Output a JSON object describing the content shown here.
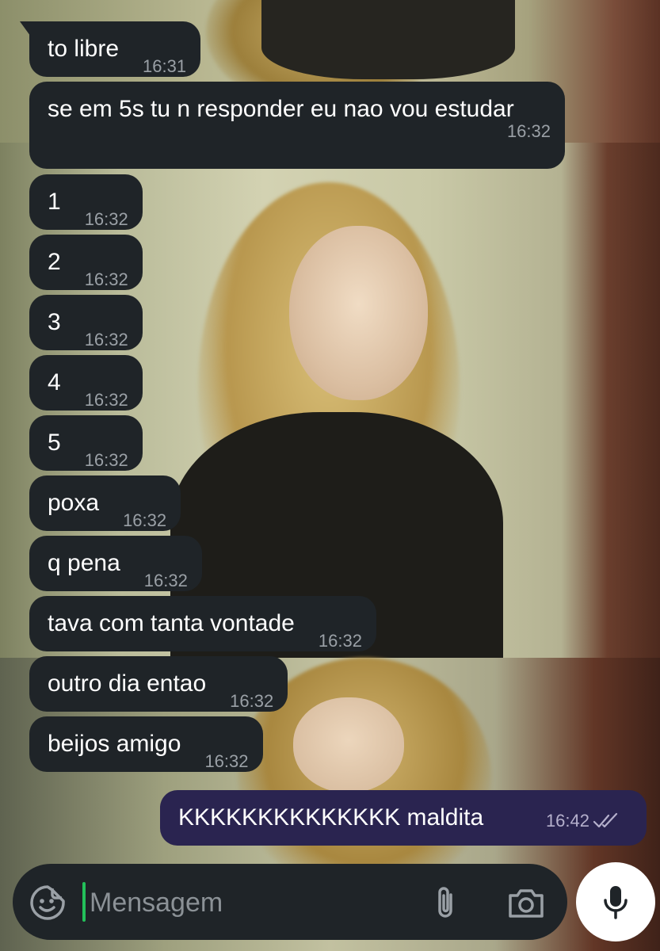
{
  "messages": [
    {
      "text": "to libre",
      "time": "16:31"
    },
    {
      "text": "se em 5s tu n responder eu nao vou estudar",
      "time": "16:32"
    },
    {
      "text": "1",
      "time": "16:32"
    },
    {
      "text": "2",
      "time": "16:32"
    },
    {
      "text": "3",
      "time": "16:32"
    },
    {
      "text": "4",
      "time": "16:32"
    },
    {
      "text": "5",
      "time": "16:32"
    },
    {
      "text": "poxa",
      "time": "16:32"
    },
    {
      "text": "q pena",
      "time": "16:32"
    },
    {
      "text": "tava com tanta vontade",
      "time": "16:32"
    },
    {
      "text": "outro dia entao",
      "time": "16:32"
    },
    {
      "text": "beijos amigo",
      "time": "16:32"
    }
  ],
  "outgoing": {
    "text": "KKKKKKKKKKKKKK maldita",
    "time": "16:42",
    "status_icon": "double-check-icon"
  },
  "composer": {
    "placeholder": "Mensagem"
  },
  "icons": {
    "emoji": "sticker-emoji-icon",
    "attach": "paperclip-icon",
    "camera": "camera-icon",
    "mic": "microphone-icon"
  },
  "colors": {
    "incoming_bubble": "#1f2428",
    "outgoing_bubble": "#2a2450",
    "cursor": "#23c05a",
    "mic_button": "#ffffff"
  }
}
